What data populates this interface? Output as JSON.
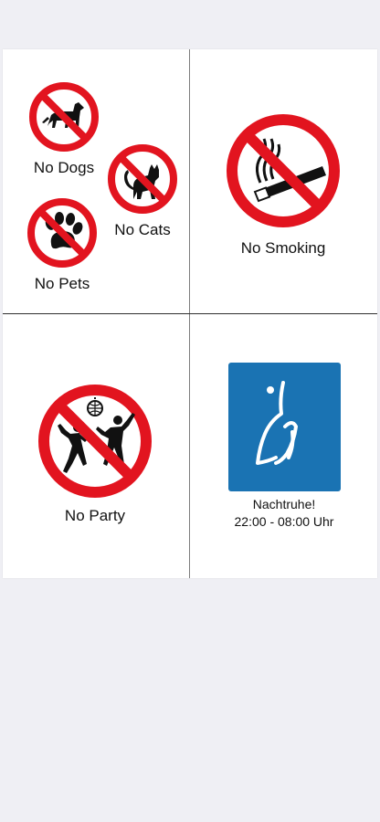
{
  "colors": {
    "prohibition_red": "#e2141f",
    "quiet_blue": "#1a73b3",
    "pictogram": "#111111"
  },
  "panels": {
    "pets": {
      "dogs_label": "No Dogs",
      "cats_label": "No Cats",
      "pets_label": "No Pets",
      "dog_icon": "dog-icon",
      "cat_icon": "cat-icon",
      "paw_icon": "paw-icon"
    },
    "smoking": {
      "label": "No Smoking",
      "icon": "cigarette-icon"
    },
    "party": {
      "label": "No Party",
      "icon": "dancing-people-icon"
    },
    "quiet": {
      "title": "Nachtruhe!",
      "hours": "22:00 - 08:00 Uhr",
      "icon": "shush-icon"
    }
  }
}
